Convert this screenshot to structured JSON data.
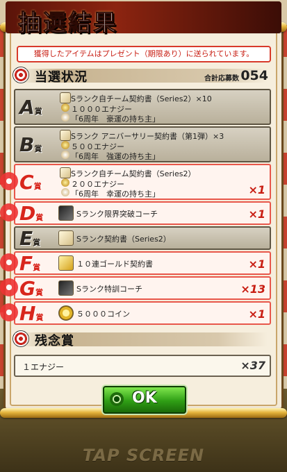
{
  "header": {
    "title": "抽選結果"
  },
  "notice": "獲得したアイテムはプレゼント（期限あり）に送られています。",
  "winners_section": {
    "title": "当選状況",
    "total_label": "合計応募数",
    "total_value": "054"
  },
  "prizes": [
    {
      "rank": "A",
      "suffix": "賞",
      "state": "lose",
      "lines": [
        "Sランク自チーム契約書（Series2）×10",
        "１０００エナジー",
        "「6周年　豪運の持ち主」"
      ],
      "mult": ""
    },
    {
      "rank": "B",
      "suffix": "賞",
      "state": "lose",
      "lines": [
        "Sランク アニバーサリー契約書（第1弾）×3",
        "５００エナジー",
        "「6周年　強運の持ち主」"
      ],
      "mult": ""
    },
    {
      "rank": "C",
      "suffix": "賞",
      "state": "win",
      "lines": [
        "Sランク自チーム契約書（Series2）",
        "２００エナジー",
        "「6周年　幸運の持ち主」"
      ],
      "mult": "×1"
    },
    {
      "rank": "D",
      "suffix": "賞",
      "state": "win",
      "lines": [
        "Sランク限界突破コーチ"
      ],
      "mult": "×1"
    },
    {
      "rank": "E",
      "suffix": "賞",
      "state": "lose",
      "lines": [
        "Sランク契約書（Series2）"
      ],
      "mult": ""
    },
    {
      "rank": "F",
      "suffix": "賞",
      "state": "win",
      "lines": [
        "１０連ゴールド契約書"
      ],
      "mult": "×1"
    },
    {
      "rank": "G",
      "suffix": "賞",
      "state": "win",
      "lines": [
        "Sランク特訓コーチ"
      ],
      "mult": "×13"
    },
    {
      "rank": "H",
      "suffix": "賞",
      "state": "win",
      "lines": [
        "５０００コイン"
      ],
      "mult": "×1"
    }
  ],
  "consolation": {
    "title": "残念賞",
    "item": "１エナジー",
    "mult": "×37"
  },
  "ok_button": {
    "label": "OK"
  },
  "tap_screen": "TAP SCREEN",
  "colors": {
    "win_border": "#e8564a",
    "lose_bg": "#c9c2b0",
    "accent_red": "#c81d12",
    "ok_green": "#2f9e15"
  },
  "icons": [
    "target-icon",
    "contract-icon",
    "energy-icon",
    "coach-icon",
    "gold-contract-icon",
    "coin-icon",
    "ok-emblem-icon"
  ]
}
